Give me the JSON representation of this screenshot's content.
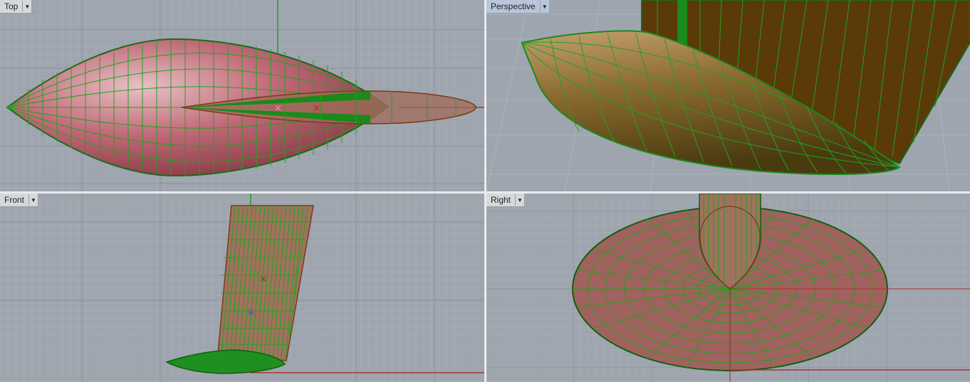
{
  "viewports": {
    "top": {
      "name": "Top",
      "menu_icon": "dropdown-arrow-icon"
    },
    "perspective": {
      "name": "Perspective",
      "menu_icon": "dropdown-arrow-icon"
    },
    "front": {
      "name": "Front",
      "menu_icon": "dropdown-arrow-icon"
    },
    "right": {
      "name": "Right",
      "menu_icon": "dropdown-arrow-icon"
    }
  },
  "colors": {
    "viewport_bg": "#9ea5ae",
    "grid_minor": "#a9afb7",
    "grid_major": "#8c939c",
    "mesh_green": "#1fa31f",
    "surface_red": "#b06060",
    "surface_brown": "#6b4a1a",
    "axis_red": "#b03030",
    "axis_green": "#20a020"
  }
}
